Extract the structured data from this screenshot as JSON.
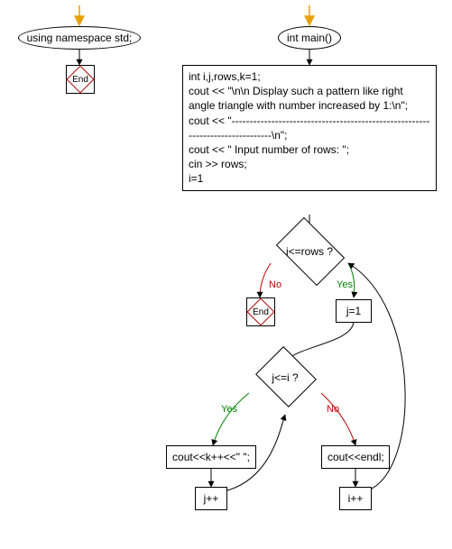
{
  "flow1": {
    "start_label": "using namespace std;",
    "end_label": "End"
  },
  "flow2": {
    "start_label": "int main()",
    "body": "int i,j,rows,k=1;\ncout << \"\\n\\n Display such a pattern like right angle triangle with number increased by 1:\\n\";\ncout << \"------------------------------------------------------------------------------\\n\";\ncout << \" Input number of rows: \";\ncin >> rows;\ni=1",
    "cond1": "i<=rows ?",
    "end_label": "End",
    "assign_j": "j=1",
    "cond2": "j<=i ?",
    "stmt_yes2": "cout<<k++<<\" \";",
    "inc_j": "j++",
    "stmt_no2": "cout<<endl;",
    "inc_i": "i++"
  },
  "edge_labels": {
    "no": "No",
    "yes": "Yes"
  }
}
